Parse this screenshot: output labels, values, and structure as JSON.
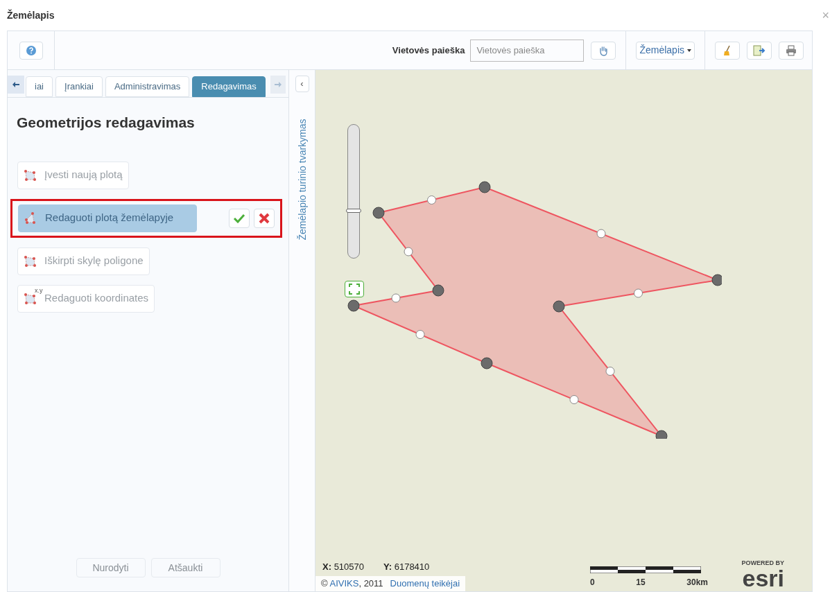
{
  "window": {
    "title": "Žemėlapis",
    "close": "×"
  },
  "toolbar": {
    "search_label": "Vietovės paieška",
    "search_placeholder": "Vietovės paieška",
    "basemap_menu": "Žemėlapis"
  },
  "tabs": [
    {
      "label": "iai",
      "selected": false
    },
    {
      "label": "Įrankiai",
      "selected": false
    },
    {
      "label": "Administravimas",
      "selected": false
    },
    {
      "label": "Redagavimas",
      "selected": true
    }
  ],
  "panel": {
    "heading": "Geometrijos redagavimas",
    "tools": [
      {
        "label": "Įvesti naują plotą",
        "selected": false,
        "kind": "new"
      },
      {
        "label": "Redaguoti plotą žemėlapyje",
        "selected": true,
        "kind": "edit"
      },
      {
        "label": "Iškirpti skylę poligone",
        "selected": false,
        "kind": "hole"
      },
      {
        "label": "Redaguoti koordinates",
        "selected": false,
        "kind": "coords",
        "badge": "x.y"
      }
    ],
    "footer_buttons": [
      {
        "label": "Nurodyti",
        "disabled": true
      },
      {
        "label": "Atšaukti",
        "disabled": true
      }
    ]
  },
  "side_strip": {
    "label": "Žemėlapio turinio tvarkymas",
    "collapse": "‹"
  },
  "map": {
    "x_label": "X:",
    "x_value": "510570",
    "y_label": "Y:",
    "y_value": "6178410",
    "zoom": {
      "level": 0.35
    },
    "copyright": "© ",
    "copyright_link": "AIVIKS",
    "copyright_year": ", 2011",
    "providers_link": "Duomenų teikėjai",
    "scale_labels": [
      "0",
      "15",
      "30km"
    ],
    "powered_by": "POWERED BY",
    "logo": "esri"
  }
}
